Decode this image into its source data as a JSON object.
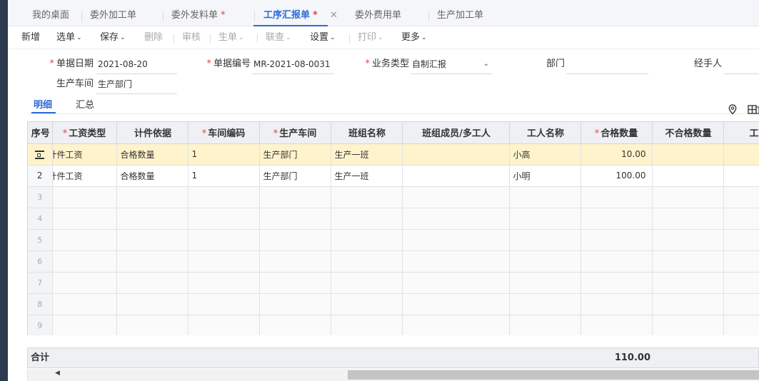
{
  "tabs": [
    {
      "label": "我的桌面",
      "star": ""
    },
    {
      "label": "委外加工单",
      "star": ""
    },
    {
      "label": "委外发料单",
      "star": "*"
    },
    {
      "label": "工序汇报单",
      "star": "*"
    },
    {
      "label": "委外费用单",
      "star": ""
    },
    {
      "label": "生产加工单",
      "star": ""
    }
  ],
  "tab_close_glyph": "✕",
  "toolbar": {
    "new": "新增",
    "select": "选单",
    "save": "保存",
    "delete": "删除",
    "audit": "审核",
    "generate": "生单",
    "link": "联查",
    "settings": "设置",
    "print": "打印",
    "more": "更多",
    "chevron": "⌄"
  },
  "form": {
    "date_label": "单据日期",
    "date_value": "2021-08-20",
    "no_label": "单据编号",
    "no_value": "MR-2021-08-0031",
    "type_label": "业务类型",
    "type_value": "自制汇报",
    "dept_label": "部门",
    "dept_value": "",
    "handler_label": "经手人",
    "handler_value": "",
    "workshop_label": "生产车间",
    "workshop_value": "生产部门",
    "req_mark": "*",
    "dropdown_glyph": "⌄"
  },
  "subtabs": {
    "detail": "明细",
    "summary": "汇总"
  },
  "icons": {
    "location": "location-pin-icon",
    "layout": "layout-icon"
  },
  "grid": {
    "headers": [
      {
        "label": "序号",
        "req": ""
      },
      {
        "label": "工资类型",
        "req": "*"
      },
      {
        "label": "计件依据",
        "req": ""
      },
      {
        "label": "车间编码",
        "req": "*"
      },
      {
        "label": "生产车间",
        "req": "*"
      },
      {
        "label": "班组名称",
        "req": ""
      },
      {
        "label": "班组成员/多工人",
        "req": ""
      },
      {
        "label": "工人名称",
        "req": ""
      },
      {
        "label": "合格数量",
        "req": "*"
      },
      {
        "label": "不合格数量",
        "req": ""
      },
      {
        "label": "工",
        "req": ""
      }
    ],
    "rows": [
      {
        "no": "",
        "wage_type": "计件工资",
        "basis": "合格数量",
        "ws_code": "1",
        "workshop": "生产部门",
        "team": "生产一班",
        "members": "",
        "worker": "小高",
        "qty": "10.00",
        "bad_qty": ""
      },
      {
        "no": "2",
        "wage_type": "计件工资",
        "basis": "合格数量",
        "ws_code": "1",
        "workshop": "生产部门",
        "team": "生产一班",
        "members": "",
        "worker": "小明",
        "qty": "100.00",
        "bad_qty": ""
      }
    ],
    "empty_rows": [
      "3",
      "4",
      "5",
      "6",
      "7",
      "8",
      "9"
    ]
  },
  "totals": {
    "label": "合计",
    "qty": "110.00"
  },
  "scroll": {
    "left_arrow": "◀"
  },
  "colors": {
    "accent": "#2d6ad6",
    "required": "#e64545",
    "selected_row": "#fff3cc",
    "sidebar": "#2b3a4e"
  }
}
